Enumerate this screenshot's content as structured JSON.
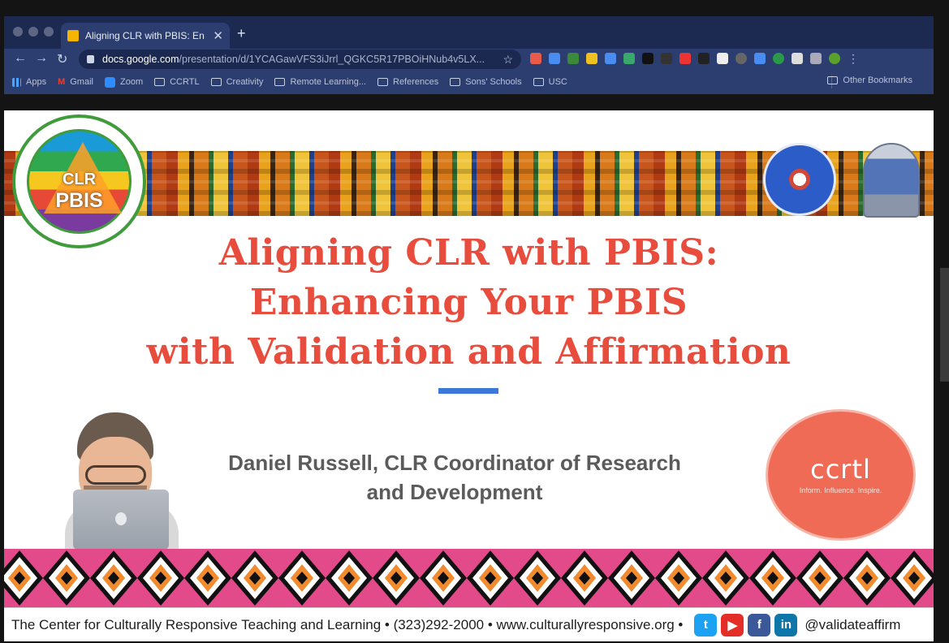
{
  "browser": {
    "tab_title": "Aligning CLR with PBIS: En",
    "url_host": "docs.google.com",
    "url_path": "/presentation/d/1YCAGawVFS3iJrrl_QGKC5R17PBOiHNub4v5LX...",
    "bookmarks": [
      "Apps",
      "Gmail",
      "Zoom",
      "CCRTL",
      "Creativity",
      "Remote Learning...",
      "References",
      "Sons' Schools",
      "USC"
    ],
    "other_bookmarks": "Other Bookmarks"
  },
  "slide": {
    "logo_left_line1": "CLR",
    "logo_left_line2": "PBIS",
    "title_line1": "Aligning CLR with PBIS:",
    "title_line2": "Enhancing Your PBIS",
    "title_line3": "with Validation and Affirmation",
    "presenter_line1": "Daniel Russell, CLR Coordinator of Research",
    "presenter_line2": "and Development",
    "logo_right_mark": "ccrtl",
    "logo_right_tagline": "Inform. Influence. Inspire.",
    "footer_text": "The Center for Culturally Responsive Teaching and Learning • (323)292-2000 •  www.culturallyresponsive.org •",
    "social_handle": "@validateaffirm"
  }
}
